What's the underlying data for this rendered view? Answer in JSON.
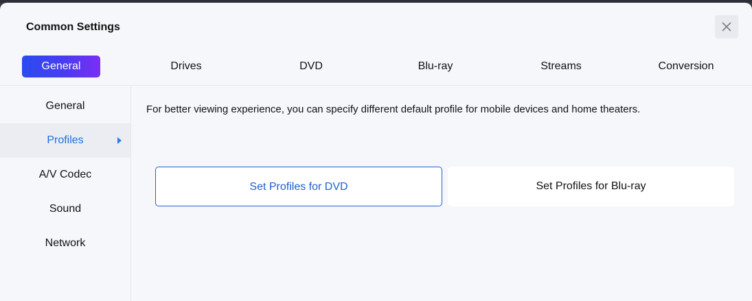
{
  "window": {
    "title": "Common Settings",
    "close_icon": "close-icon"
  },
  "tabs": [
    {
      "label": "General",
      "active": true
    },
    {
      "label": "Drives",
      "active": false
    },
    {
      "label": "DVD",
      "active": false
    },
    {
      "label": "Blu-ray",
      "active": false
    },
    {
      "label": "Streams",
      "active": false
    },
    {
      "label": "Conversion",
      "active": false
    }
  ],
  "sidebar": {
    "items": [
      {
        "label": "General",
        "active": false
      },
      {
        "label": "Profiles",
        "active": true
      },
      {
        "label": "A/V Codec",
        "active": false
      },
      {
        "label": "Sound",
        "active": false
      },
      {
        "label": "Network",
        "active": false
      }
    ]
  },
  "main": {
    "description": "For better viewing experience, you can specify different default profile for mobile devices and home theaters.",
    "buttons": [
      {
        "label": "Set Profiles for DVD",
        "selected": true
      },
      {
        "label": "Set Profiles for Blu-ray",
        "selected": false
      }
    ]
  },
  "colors": {
    "accent": "#1f5fd0",
    "tab_gradient_start": "#2a4cf0",
    "tab_gradient_end": "#7a2ff4",
    "background": "#f6f7fb"
  }
}
